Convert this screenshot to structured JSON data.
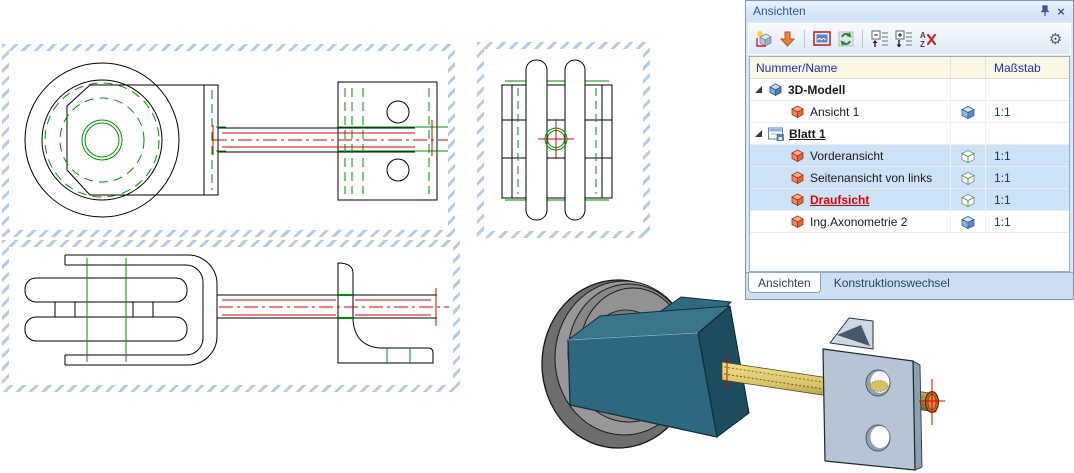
{
  "panel": {
    "title": "Ansichten",
    "titlebar_icons": [
      "pin-icon",
      "close-icon"
    ],
    "toolbar_icons": [
      "new-sheet-icon",
      "arrow-down-icon",
      "sheet-view-icon",
      "refresh-icon",
      "collapse-all-icon",
      "expand-all-icon",
      "sort-remove-icon",
      "gear-icon"
    ],
    "columns": {
      "name": "Nummer/Name",
      "scale": "Maßstab"
    },
    "rows": [
      {
        "label": "3D-Modell",
        "level": 0,
        "expanded": true,
        "tree_icon": "cube-blue-icon",
        "type_icon": "",
        "scale": "",
        "highlighted": false,
        "bold": true,
        "underline": false,
        "red": false
      },
      {
        "label": "Ansicht 1",
        "level": 1,
        "expanded": false,
        "tree_icon": "cube-orange-icon",
        "type_icon": "shaded-cube-icon",
        "scale": "1:1",
        "highlighted": false,
        "bold": false,
        "underline": false,
        "red": false
      },
      {
        "label": "Blatt 1",
        "level": 0,
        "expanded": true,
        "tree_icon": "sheet-icon",
        "type_icon": "",
        "scale": "",
        "highlighted": false,
        "bold": true,
        "underline": true,
        "red": false
      },
      {
        "label": "Vorderansicht",
        "level": 1,
        "expanded": false,
        "tree_icon": "cube-orange-icon",
        "type_icon": "wire-cube-icon",
        "scale": "1:1",
        "highlighted": true,
        "bold": false,
        "underline": false,
        "red": false
      },
      {
        "label": "Seitenansicht von links",
        "level": 1,
        "expanded": false,
        "tree_icon": "cube-orange-icon",
        "type_icon": "wire-cube-icon",
        "scale": "1:1",
        "highlighted": true,
        "bold": false,
        "underline": false,
        "red": false
      },
      {
        "label": "Draufsicht",
        "level": 1,
        "expanded": false,
        "tree_icon": "cube-orange-icon",
        "type_icon": "wire-cube-icon",
        "scale": "1:1",
        "highlighted": true,
        "bold": true,
        "underline": true,
        "red": true
      },
      {
        "label": "Ing.Axonometrie 2",
        "level": 1,
        "expanded": false,
        "tree_icon": "cube-orange-icon",
        "type_icon": "shaded-cube-icon",
        "scale": "1:1",
        "highlighted": false,
        "bold": false,
        "underline": false,
        "red": false
      }
    ],
    "tabs": [
      {
        "label": "Ansichten",
        "active": true
      },
      {
        "label": "Konstruktionswechsel",
        "active": false
      }
    ]
  },
  "drawing": {
    "views": [
      "front-view-2d",
      "left-side-view-2d",
      "top-view-2d",
      "isometric-3d-model"
    ],
    "colors": {
      "outline": "#000000",
      "hidden_line": "#009100",
      "center_line": "#e60000",
      "view_border_hatch": "#b5cce2"
    }
  },
  "model3d": {
    "colors": {
      "wheel": "#8d8d8d",
      "bracket": "#2d687e",
      "shaft": "#d8c468",
      "plate": "#b5c5d4",
      "tip": "#c06428"
    }
  }
}
